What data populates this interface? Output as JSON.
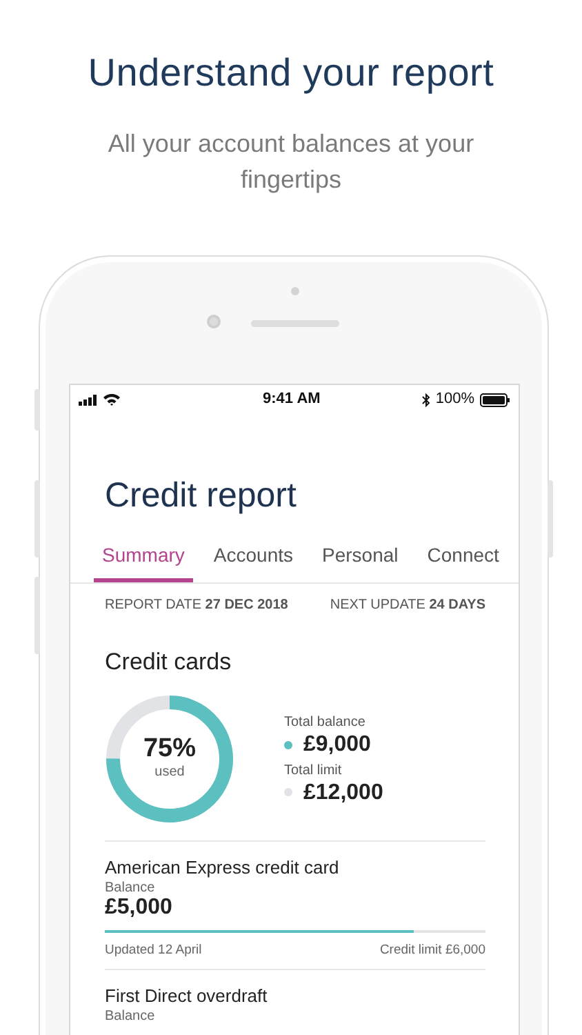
{
  "header": {
    "title": "Understand your report",
    "subtitle": "All your account balances at your fingertips"
  },
  "status_bar": {
    "time": "9:41 AM",
    "battery": "100%"
  },
  "screen_title": "Credit report",
  "tabs": [
    {
      "label": "Summary",
      "selected": true
    },
    {
      "label": "Accounts",
      "selected": false
    },
    {
      "label": "Personal",
      "selected": false
    },
    {
      "label": "Connect",
      "selected": false
    }
  ],
  "report_info": {
    "date_label": "REPORT DATE",
    "date": "27 DEC 2018",
    "update_label": "NEXT UPDATE",
    "update": "24 DAYS"
  },
  "credit_cards": {
    "title": "Credit cards",
    "usage": {
      "percent": "75%",
      "caption": "used",
      "level": 0.75
    },
    "totals": [
      {
        "label": "Total balance",
        "amount": "£9,000",
        "color": "#5cc0c0"
      },
      {
        "label": "Total limit",
        "amount": "£12,000",
        "color": "#e1e3e6"
      }
    ]
  },
  "accounts": [
    {
      "name": "American Express credit card",
      "balance_label": "Balance",
      "balance": "£5,000",
      "level": 0.81,
      "updated": "Updated 12 April",
      "limit": "Credit limit £6,000"
    },
    {
      "name": "First Direct overdraft",
      "balance_label": "Balance"
    }
  ]
}
